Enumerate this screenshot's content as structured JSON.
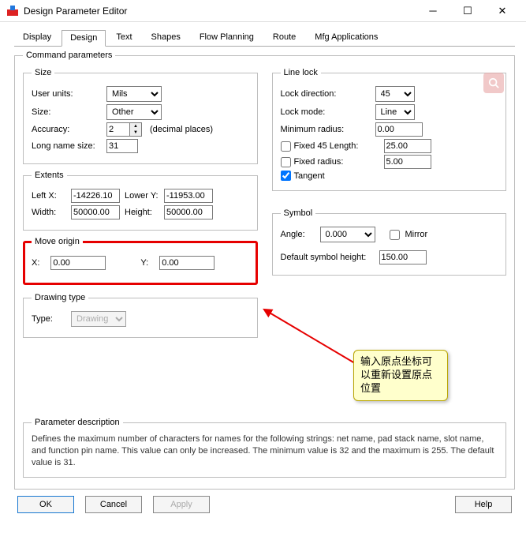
{
  "window": {
    "title": "Design Parameter Editor"
  },
  "tabs": [
    "Display",
    "Design",
    "Text",
    "Shapes",
    "Flow Planning",
    "Route",
    "Mfg Applications"
  ],
  "active_tab": 1,
  "command_params_label": "Command parameters",
  "size": {
    "legend": "Size",
    "user_units_label": "User units:",
    "user_units_value": "Mils",
    "size_label": "Size:",
    "size_value": "Other",
    "accuracy_label": "Accuracy:",
    "accuracy_value": "2",
    "accuracy_suffix": "(decimal places)",
    "long_name_label": "Long name size:",
    "long_name_value": "31"
  },
  "extents": {
    "legend": "Extents",
    "leftx_label": "Left X:",
    "leftx_value": "-14226.10",
    "lowery_label": "Lower Y:",
    "lowery_value": "-11953.00",
    "width_label": "Width:",
    "width_value": "50000.00",
    "height_label": "Height:",
    "height_value": "50000.00"
  },
  "move_origin": {
    "legend": "Move origin",
    "x_label": "X:",
    "x_value": "0.00",
    "y_label": "Y:",
    "y_value": "0.00"
  },
  "drawing_type": {
    "legend": "Drawing type",
    "type_label": "Type:",
    "type_value": "Drawing"
  },
  "line_lock": {
    "legend": "Line lock",
    "lock_direction_label": "Lock direction:",
    "lock_direction_value": "45",
    "lock_mode_label": "Lock mode:",
    "lock_mode_value": "Line",
    "min_radius_label": "Minimum radius:",
    "min_radius_value": "0.00",
    "fixed45_label": "Fixed 45 Length:",
    "fixed45_value": "25.00",
    "fixed_radius_label": "Fixed radius:",
    "fixed_radius_value": "5.00",
    "tangent_label": "Tangent"
  },
  "symbol": {
    "legend": "Symbol",
    "angle_label": "Angle:",
    "angle_value": "0.000",
    "mirror_label": "Mirror",
    "default_height_label": "Default symbol height:",
    "default_height_value": "150.00"
  },
  "param_desc": {
    "legend": "Parameter description",
    "text": "Defines the maximum number of characters for names for the following strings: net name, pad stack name, slot name, and function pin name.  This value can only be increased.  The minimum value is 32 and the maximum is 255.  The default value is 31."
  },
  "buttons": {
    "ok": "OK",
    "cancel": "Cancel",
    "apply": "Apply",
    "help": "Help"
  },
  "callout_text": "输入原点坐标可以重新设置原点位置"
}
